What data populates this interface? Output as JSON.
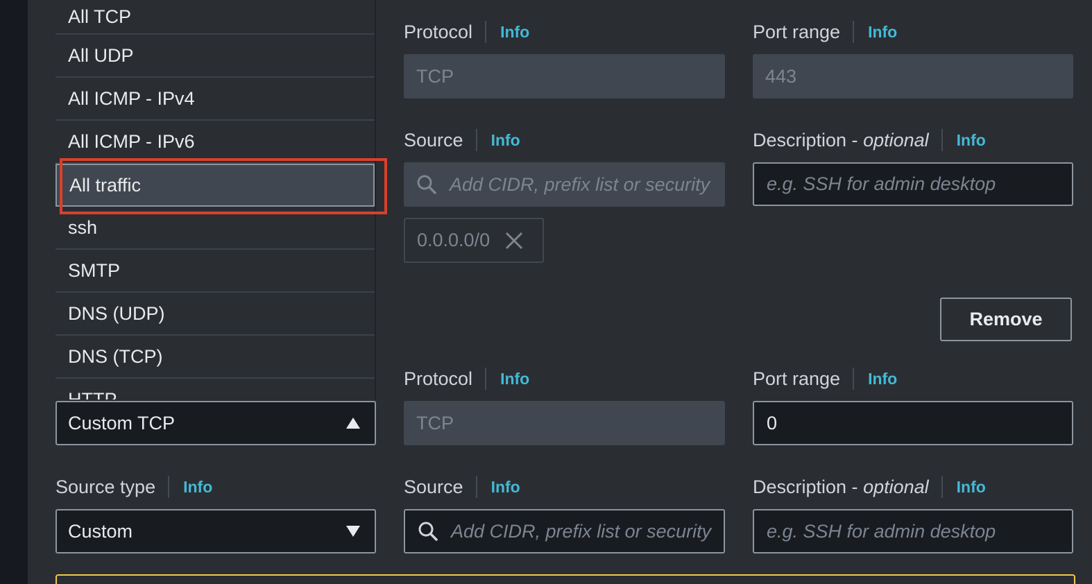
{
  "dropdown": {
    "items": [
      "All TCP",
      "All UDP",
      "All ICMP - IPv4",
      "All ICMP - IPv6",
      "All traffic",
      "ssh",
      "SMTP",
      "DNS (UDP)",
      "DNS (TCP)",
      "HTTP"
    ],
    "highlighted": "All traffic"
  },
  "rule1": {
    "protocol_label": "Protocol",
    "protocol_value": "TCP",
    "port_label": "Port range",
    "port_value": "443",
    "source_label": "Source",
    "source_placeholder": "Add CIDR, prefix list or security",
    "source_token": "0.0.0.0/0",
    "desc_label": "Description - ",
    "desc_optional": "optional",
    "desc_placeholder": "e.g. SSH for admin desktop",
    "remove_label": "Remove"
  },
  "rule2": {
    "type_value": "Custom TCP",
    "protocol_label": "Protocol",
    "protocol_value": "TCP",
    "port_label": "Port range",
    "port_value": "0",
    "source_type_label": "Source type",
    "source_type_value": "Custom",
    "source_label": "Source",
    "source_placeholder": "Add CIDR, prefix list or security",
    "desc_label": "Description - ",
    "desc_optional": "optional",
    "desc_placeholder": "e.g. SSH for admin desktop"
  },
  "info_label": "Info",
  "colors": {
    "background": "#2a2e33",
    "info_link": "#44b9d6",
    "highlight_outline": "#d9402b",
    "warning_border": "#f2c94c"
  }
}
